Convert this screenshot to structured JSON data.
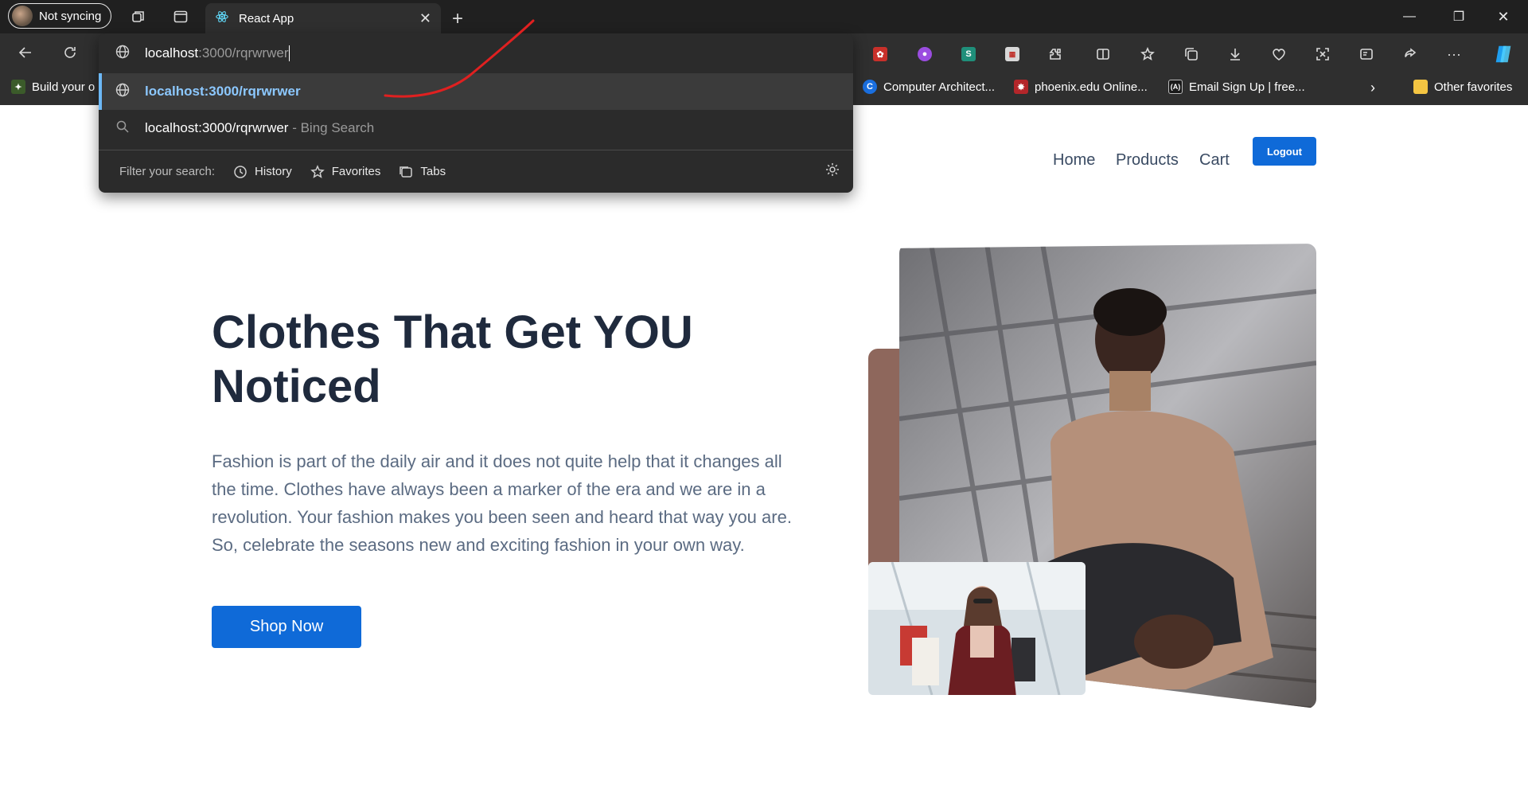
{
  "browser": {
    "profile_label": "Not syncing",
    "tab_title": "React App",
    "address_host": "localhost",
    "address_rest": ":3000/rqrwrwer",
    "suggestion_url": "localhost:3000/rqrwrwer",
    "search_query": "localhost:3000/rqrwrwer",
    "search_suffix": " - Bing Search",
    "filter_label": "Filter your search:",
    "filter_history": "History",
    "filter_favorites": "Favorites",
    "filter_tabs": "Tabs",
    "bookmarks": [
      "Build your o",
      "Computer Architect...",
      "phoenix.edu Online...",
      "Email Sign Up | free...",
      "Other favorites"
    ],
    "accent": "#6cb8f6",
    "annotation_color": "#e02020"
  },
  "nav": {
    "home": "Home",
    "products": "Products",
    "cart": "Cart",
    "logout": "Logout"
  },
  "hero": {
    "title": "Clothes That Get YOU Noticed",
    "text": "Fashion is part of the daily air and it does not quite help that it changes all the time. Clothes have always been a marker of the era and we are in a revolution. Your fashion makes you been seen and heard that way you are. So, celebrate the seasons new and exciting fashion in your own way.",
    "cta": "Shop Now",
    "primary_color": "#0f6ad8",
    "accent_block_color": "#8e675c"
  }
}
